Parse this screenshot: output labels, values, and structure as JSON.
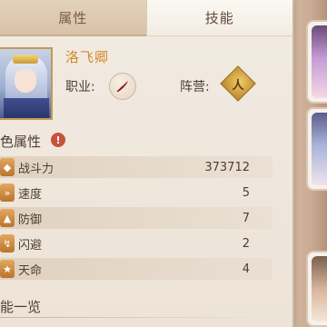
{
  "tabs": [
    {
      "label": "属性",
      "active": true
    },
    {
      "label": "技能",
      "active": false
    }
  ],
  "character": {
    "name": "洛飞卿",
    "job_label": "职业:",
    "camp_label": "阵营:",
    "job_icon": "feather-icon",
    "camp_icon": "camp-emblem-icon",
    "camp_glyph": "人"
  },
  "attributes": {
    "title": "色属性",
    "info_icon": "!",
    "rows": [
      {
        "label": "战斗力",
        "value": "373712",
        "icon": "power-icon"
      },
      {
        "label": "速度",
        "value": "5",
        "icon": "speed-icon"
      },
      {
        "label": "防御",
        "value": "7",
        "icon": "defense-icon"
      },
      {
        "label": "闪避",
        "value": "2",
        "icon": "dodge-icon"
      },
      {
        "label": "天命",
        "value": "4",
        "icon": "fate-icon"
      }
    ]
  },
  "skills_section": {
    "title": "能一览"
  },
  "colors": {
    "accent_name": "#d8862d",
    "tab_active": "#d8c2a8",
    "icon_orange": "#c98a3f",
    "warning_red": "#c6533c"
  }
}
